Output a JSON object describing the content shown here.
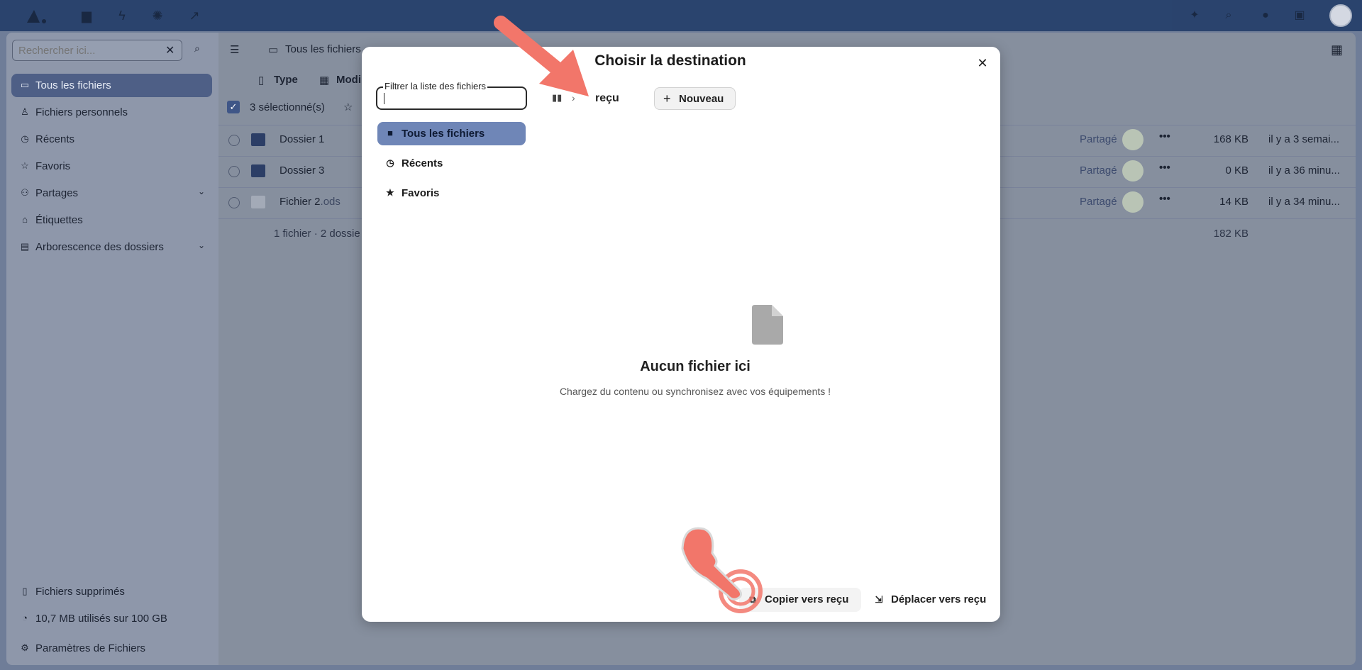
{
  "topbar": {
    "apps": [
      "files-icon",
      "activity-icon",
      "announcements-icon",
      "flow-icon"
    ],
    "right": [
      "assistant-icon",
      "search-icon",
      "notifications-icon",
      "contacts-icon"
    ]
  },
  "sidebar": {
    "search_placeholder": "Rechercher ici...",
    "items": [
      {
        "label": "Tous les fichiers",
        "icon": "folder-icon",
        "active": true
      },
      {
        "label": "Fichiers personnels",
        "icon": "user-icon"
      },
      {
        "label": "Récents",
        "icon": "clock-icon"
      },
      {
        "label": "Favoris",
        "icon": "star-icon"
      },
      {
        "label": "Partages",
        "icon": "share-icon",
        "expand": true
      },
      {
        "label": "Étiquettes",
        "icon": "tag-icon"
      },
      {
        "label": "Arborescence des dossiers",
        "icon": "folder-tree-icon",
        "expand": true
      }
    ],
    "footer": {
      "trash": "Fichiers supprimés",
      "quota": "10,7 MB utilisés sur 100 GB",
      "settings": "Paramètres de Fichiers"
    }
  },
  "main": {
    "breadcrumb": "Tous les fichiers",
    "filters": {
      "type": "Type",
      "modified": "Modi"
    },
    "selection": "3 sélectionné(s)",
    "rows": [
      {
        "name": "Dossier 1",
        "ext": "",
        "shared": "Partagé",
        "size": "168 KB",
        "date": "il y a 3 semai..."
      },
      {
        "name": "Dossier 3",
        "ext": "",
        "shared": "Partagé",
        "size": "0 KB",
        "date": "il y a 36 minu..."
      },
      {
        "name": "Fichier 2",
        "ext": ".ods",
        "shared": "Partagé",
        "size": "14 KB",
        "date": "il y a 34 minu..."
      }
    ],
    "summary": "1 fichier · 2 dossie",
    "total_size": "182 KB"
  },
  "modal": {
    "title": "Choisir la destination",
    "filter_label": "Filtrer la liste des fichiers",
    "filter_value": "",
    "breadcrumb_current": "reçu",
    "new_button": "Nouveau",
    "nav": [
      {
        "label": "Tous les fichiers",
        "icon": "folder-icon",
        "active": true
      },
      {
        "label": "Récents",
        "icon": "clock-icon"
      },
      {
        "label": "Favoris",
        "icon": "star-icon"
      }
    ],
    "empty_title": "Aucun fichier ici",
    "empty_desc": "Chargez du contenu ou synchronisez avec vos équipements !",
    "copy_button": "Copier vers reçu",
    "move_button": "Déplacer vers reçu"
  },
  "colors": {
    "accent": "#6f86b7",
    "overlay": "#6f7d98",
    "annotation": "#f2766a"
  }
}
